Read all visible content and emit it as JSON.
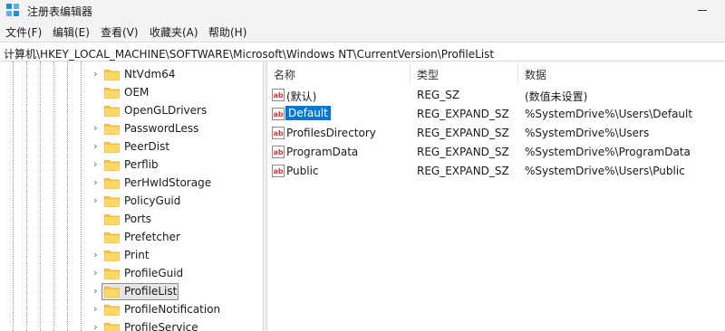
{
  "window": {
    "title": "注册表编辑器"
  },
  "menu": [
    "文件(F)",
    "编辑(E)",
    "查看(V)",
    "收藏夹(A)",
    "帮助(H)"
  ],
  "address": "计算机\\HKEY_LOCAL_MACHINE\\SOFTWARE\\Microsoft\\Windows NT\\CurrentVersion\\ProfileList",
  "tree": {
    "items": [
      {
        "label": "NtVdm64",
        "expandable": true,
        "selected": false
      },
      {
        "label": "OEM",
        "expandable": false,
        "selected": false
      },
      {
        "label": "OpenGLDrivers",
        "expandable": false,
        "selected": false
      },
      {
        "label": "PasswordLess",
        "expandable": true,
        "selected": false
      },
      {
        "label": "PeerDist",
        "expandable": true,
        "selected": false
      },
      {
        "label": "Perflib",
        "expandable": true,
        "selected": false
      },
      {
        "label": "PerHwIdStorage",
        "expandable": true,
        "selected": false
      },
      {
        "label": "PolicyGuid",
        "expandable": true,
        "selected": false
      },
      {
        "label": "Ports",
        "expandable": false,
        "selected": false
      },
      {
        "label": "Prefetcher",
        "expandable": false,
        "selected": false
      },
      {
        "label": "Print",
        "expandable": true,
        "selected": false
      },
      {
        "label": "ProfileGuid",
        "expandable": true,
        "selected": false
      },
      {
        "label": "ProfileList",
        "expandable": true,
        "selected": true
      },
      {
        "label": "ProfileNotification",
        "expandable": true,
        "selected": false
      },
      {
        "label": "ProfileService",
        "expandable": true,
        "selected": false
      }
    ]
  },
  "values": {
    "columns": [
      "名称",
      "类型",
      "数据"
    ],
    "rows": [
      {
        "name": "(默认)",
        "type": "REG_SZ",
        "data": "(数值未设置)",
        "selected": false
      },
      {
        "name": "Default",
        "type": "REG_EXPAND_SZ",
        "data": "%SystemDrive%\\Users\\Default",
        "selected": true
      },
      {
        "name": "ProfilesDirectory",
        "type": "REG_EXPAND_SZ",
        "data": "%SystemDrive%\\Users",
        "selected": false
      },
      {
        "name": "ProgramData",
        "type": "REG_EXPAND_SZ",
        "data": "%SystemDrive%\\ProgramData",
        "selected": false
      },
      {
        "name": "Public",
        "type": "REG_EXPAND_SZ",
        "data": "%SystemDrive%\\Users\\Public",
        "selected": false
      }
    ]
  },
  "icons": {
    "app": "registry-editor-icon",
    "folder": "folder-icon",
    "value": "string-value-icon",
    "expand": "chevron-right-icon"
  },
  "colors": {
    "selection": "#0078d4",
    "folder": "#ffc83d",
    "value_icon": "#d13438",
    "tree_selection": "#e5e5e5"
  }
}
